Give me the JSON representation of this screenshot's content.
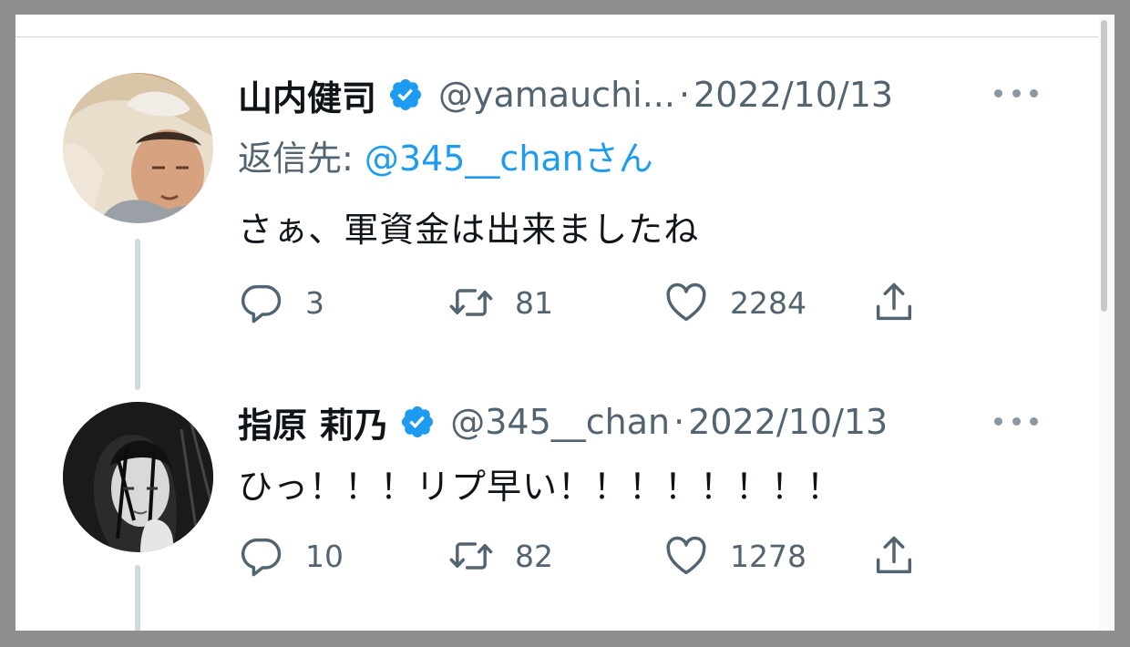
{
  "tweets": [
    {
      "name": "山内健司",
      "handle": "@yamauchi...",
      "separator": "·",
      "date": "2022/10/13",
      "reply_label": "返信先: ",
      "reply_mention": "@345__chanさん",
      "text": "さぁ、軍資金は出来ましたね",
      "reply_icon": "reply-icon",
      "counts": {
        "replies": "3",
        "retweets": "81",
        "likes": "2284"
      }
    },
    {
      "name": "指原 莉乃",
      "handle": "@345__chan",
      "separator": "·",
      "date": "2022/10/13",
      "text": "ひっ！！！リプ早い！！！！！！！！",
      "counts": {
        "replies": "10",
        "retweets": "82",
        "likes": "1278"
      }
    }
  ],
  "icons": {
    "verified": "verified-badge-icon",
    "more": "more-options-icon",
    "reply": "reply-icon",
    "retweet": "retweet-icon",
    "like": "heart-icon",
    "share": "share-icon"
  },
  "colors": {
    "accent": "#1d9bf0",
    "text": "#0f1419",
    "secondary": "#536471",
    "background": "#ffffff",
    "outer_background": "#8e8e8e"
  }
}
